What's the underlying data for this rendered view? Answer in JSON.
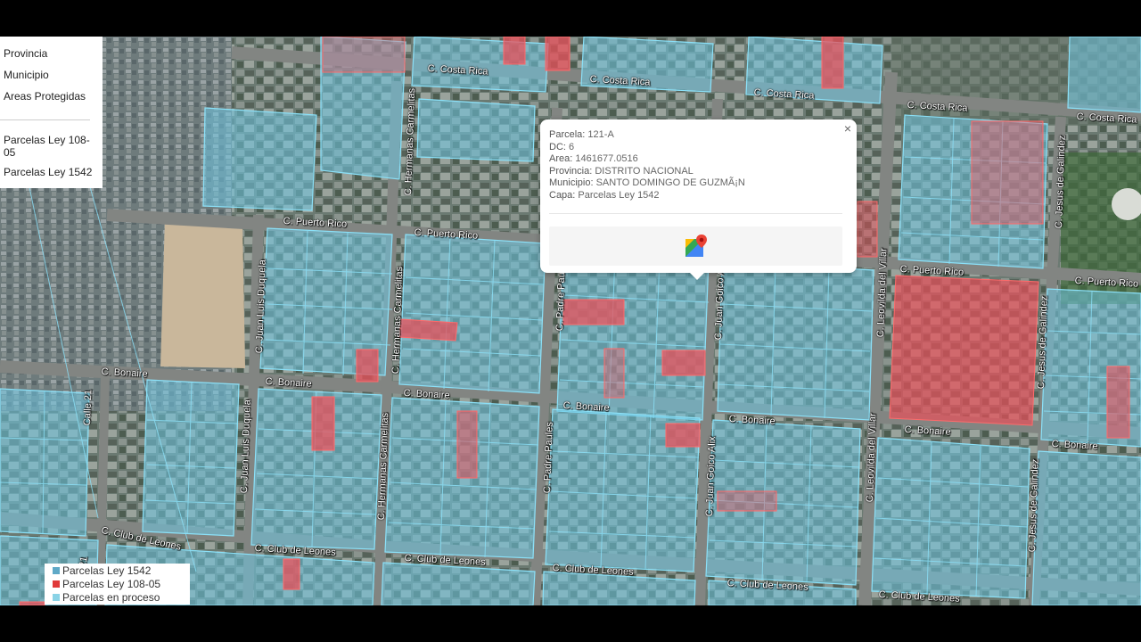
{
  "layer_panel": {
    "items": [
      "Provincia",
      "Municipio",
      "Areas Protegidas"
    ],
    "overlays": [
      "Parcelas Ley 108-05",
      "Parcelas Ley 1542"
    ]
  },
  "popup": {
    "close_label": "×",
    "fields": [
      {
        "key": "Parcela:",
        "value": "121-A"
      },
      {
        "key": "DC:",
        "value": "6"
      },
      {
        "key": "Area:",
        "value": "1461677.0516"
      },
      {
        "key": "Provincia:",
        "value": "DISTRITO NACIONAL"
      },
      {
        "key": "Municipio:",
        "value": "SANTO DOMINGO DE GUZMÃ¡N"
      },
      {
        "key": "Capa:",
        "value": "Parcelas Ley 1542"
      }
    ],
    "button_icon": "google-maps-icon"
  },
  "legend": [
    {
      "label": "Parcelas Ley 1542",
      "color": "#5fa9c7"
    },
    {
      "label": "Parcelas Ley 108-05",
      "color": "#e03a3a"
    },
    {
      "label": "Parcelas en proceso",
      "color": "#8ad3e6"
    }
  ],
  "streets": {
    "costa_rica": "C. Costa Rica",
    "puerto_rico": "C. Puerto Rico",
    "bonaire": "C. Bonaire",
    "club_de_leones": "C. Club de Leones",
    "juan_luis_duquela": "C. Juan Luis Duquela",
    "hermanas_carmelitas": "C. Hermanas Carmelitas",
    "padre_paules": "C. Padre Paules",
    "juan_goico_alix": "C. Juan Goico Alix",
    "leovilda_del_villar": "C. Leovilda del Villar",
    "jesus_de_galindez": "C. Jesus de Galindez",
    "calle_21": "Calle 21"
  },
  "colors": {
    "parcel_1542": "#6fc6e2",
    "parcel_10805": "#e8505a",
    "satellite_base": "#5d6f66"
  }
}
